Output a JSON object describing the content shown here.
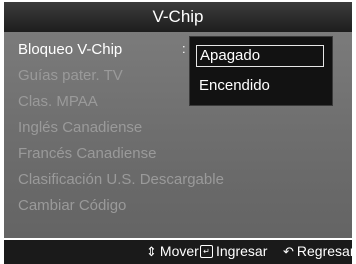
{
  "title": "V-Chip",
  "menu": {
    "items": [
      {
        "label": "Bloqueo V-Chip",
        "active": true
      },
      {
        "label": "Guías pater. TV",
        "active": false
      },
      {
        "label": "Clas. MPAA",
        "active": false
      },
      {
        "label": "Inglés Canadiense",
        "active": false
      },
      {
        "label": "Francés Canadiense",
        "active": false
      },
      {
        "label": "Clasificación U.S. Descargable",
        "active": false
      },
      {
        "label": "Cambiar Código",
        "active": false
      }
    ],
    "separator": ":"
  },
  "dropdown": {
    "options": [
      {
        "label": "Apagado",
        "selected": true
      },
      {
        "label": "Encendido",
        "selected": false
      }
    ]
  },
  "footer": {
    "move_label": "Mover",
    "move_icon": "up-down-arrow-icon",
    "enter_label": "Ingresar",
    "enter_icon": "enter-icon",
    "return_label": "Regresar",
    "return_icon": "return-icon"
  },
  "colors": {
    "title_bar": "#2a2a2a",
    "panel": "#6e6e6e",
    "active_text": "#ffffff",
    "inactive_text": "#9a9a9a",
    "dropdown_bg": "#121212"
  }
}
